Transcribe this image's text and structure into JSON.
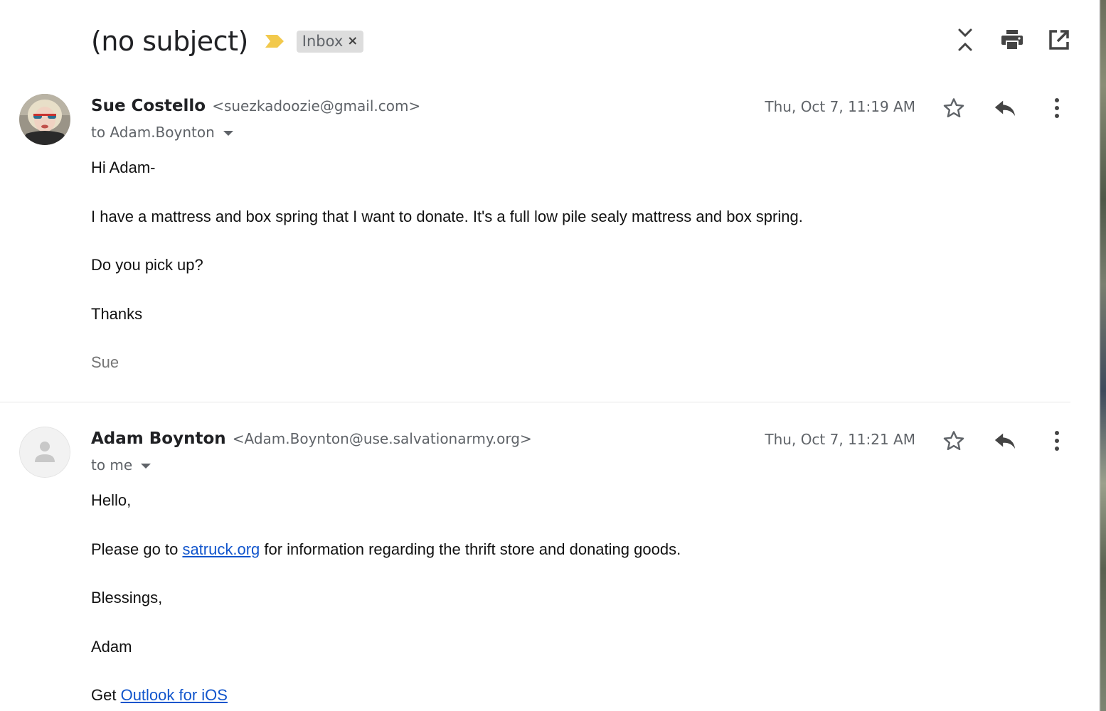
{
  "header": {
    "subject": "(no subject)",
    "label": "Inbox",
    "label_remove": "×",
    "importance_color": "#f2c94c"
  },
  "toolbar": {
    "icons": [
      "expand-collapse-icon",
      "print-icon",
      "open-in-new-window-icon"
    ]
  },
  "messages": [
    {
      "sender_name": "Sue Costello",
      "sender_email": "<suezkadoozie@gmail.com>",
      "to": "to Adam.Boynton",
      "timestamp": "Thu, Oct 7, 11:19 AM",
      "body": {
        "p1": "Hi Adam-",
        "p2": "I have a mattress and box spring that I want to donate. It's a full low pile sealy mattress and box spring.",
        "p3": "Do you pick up?",
        "p4": "Thanks",
        "signature": "Sue"
      }
    },
    {
      "sender_name": "Adam Boynton",
      "sender_email": "<Adam.Boynton@use.salvationarmy.org>",
      "to": "to me",
      "timestamp": "Thu, Oct 7, 11:21 AM",
      "body": {
        "p1": "Hello,",
        "p2_before": "Please go to ",
        "p2_link": "satruck.org",
        "p2_after": " for information regarding the thrift store and donating goods.",
        "p3": "Blessings,",
        "p4": "Adam",
        "p5_before": "Get ",
        "p5_link": "Outlook for iOS"
      }
    }
  ],
  "colors": {
    "link": "#1155cc",
    "text_secondary": "#5f6368",
    "chip_bg": "#dddddd"
  }
}
